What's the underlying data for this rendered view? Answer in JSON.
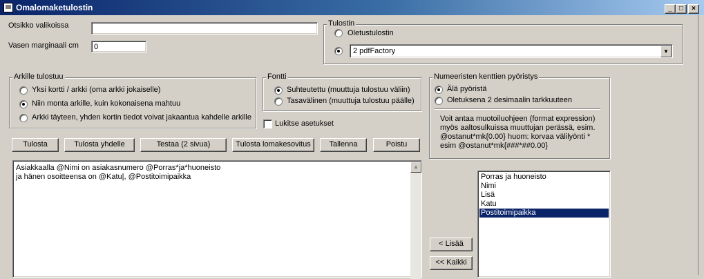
{
  "window": {
    "title": "Omalomaketulostin",
    "controls": {
      "minimize": "_",
      "maximize": "□",
      "close": "×"
    }
  },
  "header_form": {
    "title_label": "Otsikko valikoissa",
    "title_value": "",
    "margin_label": "Vasen marginaali cm",
    "margin_value": "0"
  },
  "printer": {
    "legend": "Tulostin",
    "default_option": "Oletustulostin",
    "selected": "2 pdfFactory"
  },
  "per_sheet": {
    "legend": "Arkille tulostuu",
    "options": [
      {
        "label": "Yksi kortti / arkki (oma arkki jokaiselle)",
        "checked": false
      },
      {
        "label": "Niin monta arkille, kuin kokonaisena mahtuu",
        "checked": true
      },
      {
        "label": "Arkki täyteen, yhden kortin tiedot voivat jakaantua kahdelle arkille",
        "checked": false
      }
    ]
  },
  "font": {
    "legend": "Fontti",
    "options": [
      {
        "label": "Suhteutettu (muuttuja tulostuu väliin)",
        "checked": true
      },
      {
        "label": "Tasavälinen (muuttuja tulostuu päälle)",
        "checked": false
      }
    ]
  },
  "lock_settings": {
    "label": "Lukitse asetukset",
    "checked": false
  },
  "rounding": {
    "legend": "Numeeristen kenttien pyöristys",
    "options": [
      {
        "label": "Älä pyöristä",
        "checked": true
      },
      {
        "label": "Oletuksena 2 desimaalin tarkkuuteen",
        "checked": false
      }
    ],
    "info_lines": [
      "Voit antaa muotoiluohjeen (format expression)",
      "myös aaltosulkuissa muuttujan perässä, esim.",
      "@ostanut*mk{0.00} huom: korvaa välilyönti  *",
      "esim @ostanut*mk{###*##0.00}"
    ]
  },
  "buttons": {
    "print": "Tulosta",
    "print_single": "Tulosta yhdelle",
    "test": "Testaa (2 sivua)",
    "print_fit": "Tulosta lomakesovitus",
    "save": "Tallenna",
    "delete": "Poistu",
    "add": "< Lisää",
    "add_all": "<< Kaikki"
  },
  "editor": {
    "lines": [
      "Asiakkaalla @Nimi on asiakasnumero @Porras*ja*huoneisto",
      "ja hänen osoitteensa on @Katu|, @Postitoimipaikka"
    ]
  },
  "fields": {
    "items": [
      "Porras ja huoneisto",
      "Nimi",
      "Lisä",
      "Katu",
      "Postitoimipaikka"
    ],
    "selected_index": 4
  },
  "colors": {
    "face": "#d4d0c8",
    "titlebar_start": "#0a246a",
    "titlebar_end": "#a6caf0",
    "selection": "#0a246a"
  }
}
